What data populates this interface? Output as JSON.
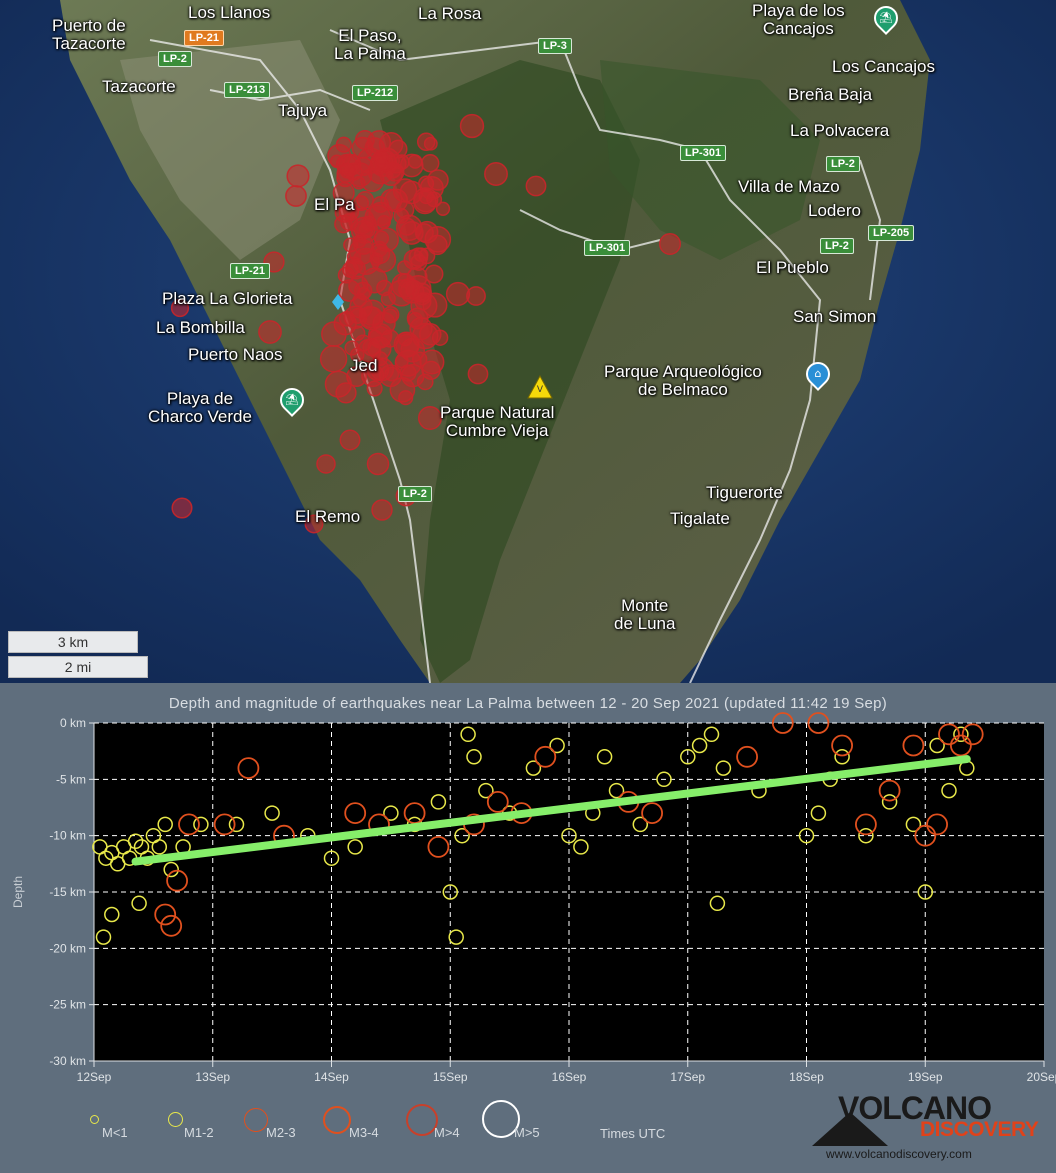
{
  "map": {
    "place_labels": [
      {
        "text": "Puerto de\nTazacorte"
      },
      {
        "text": "Los Llanos"
      },
      {
        "text": "La Rosa"
      },
      {
        "text": "El Paso,\nLa Palma"
      },
      {
        "text": "Tazacorte"
      },
      {
        "text": "Tajuya"
      },
      {
        "text": "Playa de los\nCancajos"
      },
      {
        "text": "Los Cancajos"
      },
      {
        "text": "Breña Baja"
      },
      {
        "text": "La Polvacera"
      },
      {
        "text": "Villa de Mazo"
      },
      {
        "text": "Lodero"
      },
      {
        "text": "El Pueblo"
      },
      {
        "text": "San Simon"
      },
      {
        "text": "El Pa"
      },
      {
        "text": "Plaza La Glorieta"
      },
      {
        "text": "La Bombilla"
      },
      {
        "text": "Puerto Naos"
      },
      {
        "text": "Jed"
      },
      {
        "text": "Playa de\nCharco Verde"
      },
      {
        "text": "Parque Natural\nCumbre Vieja"
      },
      {
        "text": "Parque Arqueológico\nde Belmaco"
      },
      {
        "text": "El Remo"
      },
      {
        "text": "Tiguerorte"
      },
      {
        "text": "Tigalate"
      },
      {
        "text": "Monte\nde Luna"
      }
    ],
    "road_labels": [
      "LP-21",
      "LP-2",
      "LP-3",
      "LP-213",
      "LP-212",
      "LP-301",
      "LP-2",
      "LP-301",
      "LP-2",
      "LP-205",
      "LP-21",
      "LP-2"
    ],
    "scale": {
      "km": "3 km",
      "mi": "2 mi"
    },
    "colors": {
      "earthquake": "#c8262a",
      "volcano_marker": "#f5d90a",
      "poi_pin": "#1f9e6e",
      "poi_pin_blue": "#2a8fd6"
    }
  },
  "chart": {
    "title": "Depth and magnitude of earthquakes near La Palma between 12 - 20 Sep 2021 (updated 11:42 19 Sep)",
    "ylabel": "Depth",
    "y_ticks": [
      "0 km",
      "-5 km",
      "-10 km",
      "-15 km",
      "-20 km",
      "-25 km",
      "-30 km"
    ],
    "x_ticks": [
      "12Sep",
      "13Sep",
      "14Sep",
      "15Sep",
      "16Sep",
      "17Sep",
      "18Sep",
      "19Sep",
      "20Sep"
    ],
    "legend": [
      {
        "label": "M<1",
        "color": "#e8e84a"
      },
      {
        "label": "M1-2",
        "color": "#e8e84a"
      },
      {
        "label": "M2-3",
        "color": "#e0501e"
      },
      {
        "label": "M3-4",
        "color": "#e0501e"
      },
      {
        "label": "M>4",
        "color": "#e0501e"
      },
      {
        "label": "M>5",
        "color": "#ffffff"
      }
    ],
    "times_label": "Times UTC",
    "logo": {
      "line1": "VOLCANO",
      "line2": "DISCOVERY",
      "url": "www.volcanodiscovery.com"
    }
  },
  "chart_data": {
    "type": "scatter",
    "title": "Depth and magnitude of earthquakes near La Palma between 12 - 20 Sep 2021 (updated 11:42 19 Sep)",
    "xlabel": "",
    "ylabel": "Depth",
    "xlim": [
      12,
      20
    ],
    "ylim": [
      -30,
      0
    ],
    "grid": true,
    "series": [
      {
        "name": "M1-2",
        "points": [
          [
            12.05,
            -11
          ],
          [
            12.1,
            -12
          ],
          [
            12.15,
            -11.5
          ],
          [
            12.2,
            -12.5
          ],
          [
            12.25,
            -11
          ],
          [
            12.3,
            -12
          ],
          [
            12.35,
            -10.5
          ],
          [
            12.4,
            -11
          ],
          [
            12.45,
            -12
          ],
          [
            12.5,
            -10
          ],
          [
            12.55,
            -11
          ],
          [
            12.6,
            -9
          ],
          [
            12.08,
            -19
          ],
          [
            12.15,
            -17
          ],
          [
            12.38,
            -16
          ],
          [
            12.65,
            -13
          ],
          [
            12.75,
            -11
          ],
          [
            12.9,
            -9
          ],
          [
            13.2,
            -9
          ],
          [
            13.5,
            -8
          ],
          [
            13.8,
            -10
          ],
          [
            14.0,
            -12
          ],
          [
            14.2,
            -11
          ],
          [
            14.5,
            -8
          ],
          [
            14.7,
            -9
          ],
          [
            14.9,
            -7
          ],
          [
            15.0,
            -15
          ],
          [
            15.05,
            -19
          ],
          [
            15.1,
            -10
          ],
          [
            15.15,
            -1
          ],
          [
            15.2,
            -3
          ],
          [
            15.3,
            -6
          ],
          [
            15.5,
            -8
          ],
          [
            15.7,
            -4
          ],
          [
            15.9,
            -2
          ],
          [
            16.0,
            -10
          ],
          [
            16.1,
            -11
          ],
          [
            16.2,
            -8
          ],
          [
            16.3,
            -3
          ],
          [
            16.4,
            -6
          ],
          [
            16.6,
            -9
          ],
          [
            16.8,
            -5
          ],
          [
            17.0,
            -3
          ],
          [
            17.1,
            -2
          ],
          [
            17.2,
            -1
          ],
          [
            17.25,
            -16
          ],
          [
            17.3,
            -4
          ],
          [
            17.6,
            -6
          ],
          [
            18.0,
            -10
          ],
          [
            18.1,
            -8
          ],
          [
            18.2,
            -5
          ],
          [
            18.3,
            -3
          ],
          [
            18.5,
            -10
          ],
          [
            18.7,
            -7
          ],
          [
            18.9,
            -9
          ],
          [
            19.0,
            -15
          ],
          [
            19.1,
            -2
          ],
          [
            19.2,
            -6
          ],
          [
            19.3,
            -1
          ],
          [
            19.35,
            -4
          ]
        ]
      },
      {
        "name": "M2-3",
        "points": [
          [
            12.6,
            -17
          ],
          [
            12.65,
            -18
          ],
          [
            12.7,
            -14
          ],
          [
            12.8,
            -9
          ],
          [
            13.1,
            -9
          ],
          [
            13.3,
            -4
          ],
          [
            13.6,
            -10
          ],
          [
            14.2,
            -8
          ],
          [
            14.4,
            -9
          ],
          [
            14.7,
            -8
          ],
          [
            14.9,
            -11
          ],
          [
            15.2,
            -9
          ],
          [
            15.4,
            -7
          ],
          [
            15.6,
            -8
          ],
          [
            15.8,
            -3
          ],
          [
            16.5,
            -7
          ],
          [
            16.7,
            -8
          ],
          [
            17.5,
            -3
          ],
          [
            17.8,
            0
          ],
          [
            18.1,
            0
          ],
          [
            18.3,
            -2
          ],
          [
            18.5,
            -9
          ],
          [
            18.7,
            -6
          ],
          [
            18.9,
            -2
          ],
          [
            19.0,
            -10
          ],
          [
            19.1,
            -9
          ],
          [
            19.2,
            -1
          ],
          [
            19.3,
            -2
          ],
          [
            19.4,
            -1
          ]
        ]
      }
    ],
    "trendline": {
      "x": [
        12.35,
        19.35
      ],
      "y": [
        -12.3,
        -3.2
      ],
      "color": "#86ee6a"
    }
  }
}
